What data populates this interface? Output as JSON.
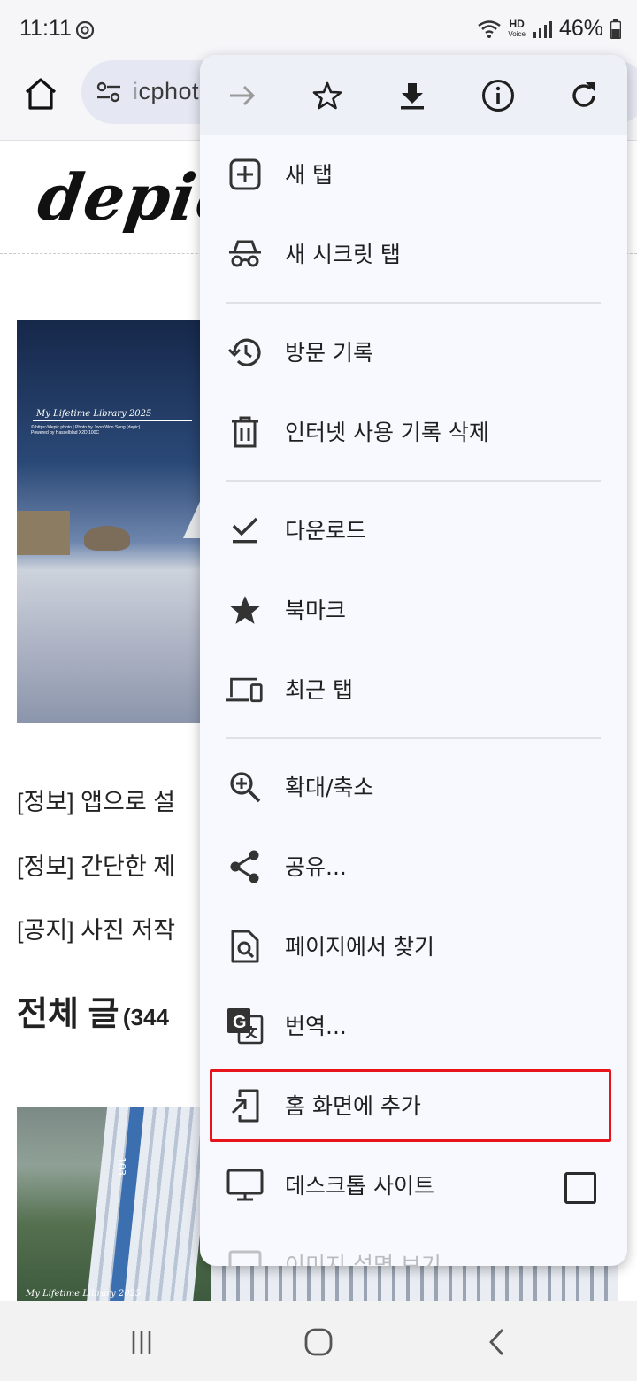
{
  "status_bar": {
    "time": "11:11",
    "hd": "HD",
    "voice": "Voice",
    "battery": "46%"
  },
  "toolbar": {
    "url_prefix": "i",
    "url_text": "cphot"
  },
  "page": {
    "logo": "depic.",
    "photo1_watermark": "My Lifetime Library 2025",
    "photo1_watermark_sub": "© https://depic.photo | Photo by Joon Woo Song (depic)",
    "photo1_watermark_sub2": "Powered by Hasselblad X2D 100C",
    "posts": [
      "[정보] 앱으로 설",
      "[정보] 간단한 제",
      "[공지] 사진 저작"
    ],
    "heading": "전체 글",
    "heading_count": "(344",
    "photo2_tower_number": "103",
    "photo2_watermark": "My Lifetime Library 2025"
  },
  "menu": {
    "items": [
      {
        "label": "새 탭",
        "icon": "new-tab-icon"
      },
      {
        "label": "새 시크릿 탭",
        "icon": "incognito-icon"
      },
      {
        "label": "방문 기록",
        "icon": "history-icon"
      },
      {
        "label": "인터넷 사용 기록 삭제",
        "icon": "trash-icon"
      },
      {
        "label": "다운로드",
        "icon": "download-done-icon"
      },
      {
        "label": "북마크",
        "icon": "star-filled-icon"
      },
      {
        "label": "최근 탭",
        "icon": "devices-icon"
      },
      {
        "label": "확대/축소",
        "icon": "zoom-in-icon"
      },
      {
        "label": "공유...",
        "icon": "share-icon"
      },
      {
        "label": "페이지에서 찾기",
        "icon": "find-in-page-icon"
      },
      {
        "label": "번역...",
        "icon": "translate-icon"
      },
      {
        "label": "홈 화면에 추가",
        "icon": "add-to-home-icon"
      },
      {
        "label": "데스크톱 사이트",
        "icon": "desktop-icon"
      },
      {
        "label": "이미지 설명 보기",
        "icon": "image-description-icon"
      }
    ],
    "desktop_site_checked": false,
    "highlight_color": "#e8141b"
  }
}
